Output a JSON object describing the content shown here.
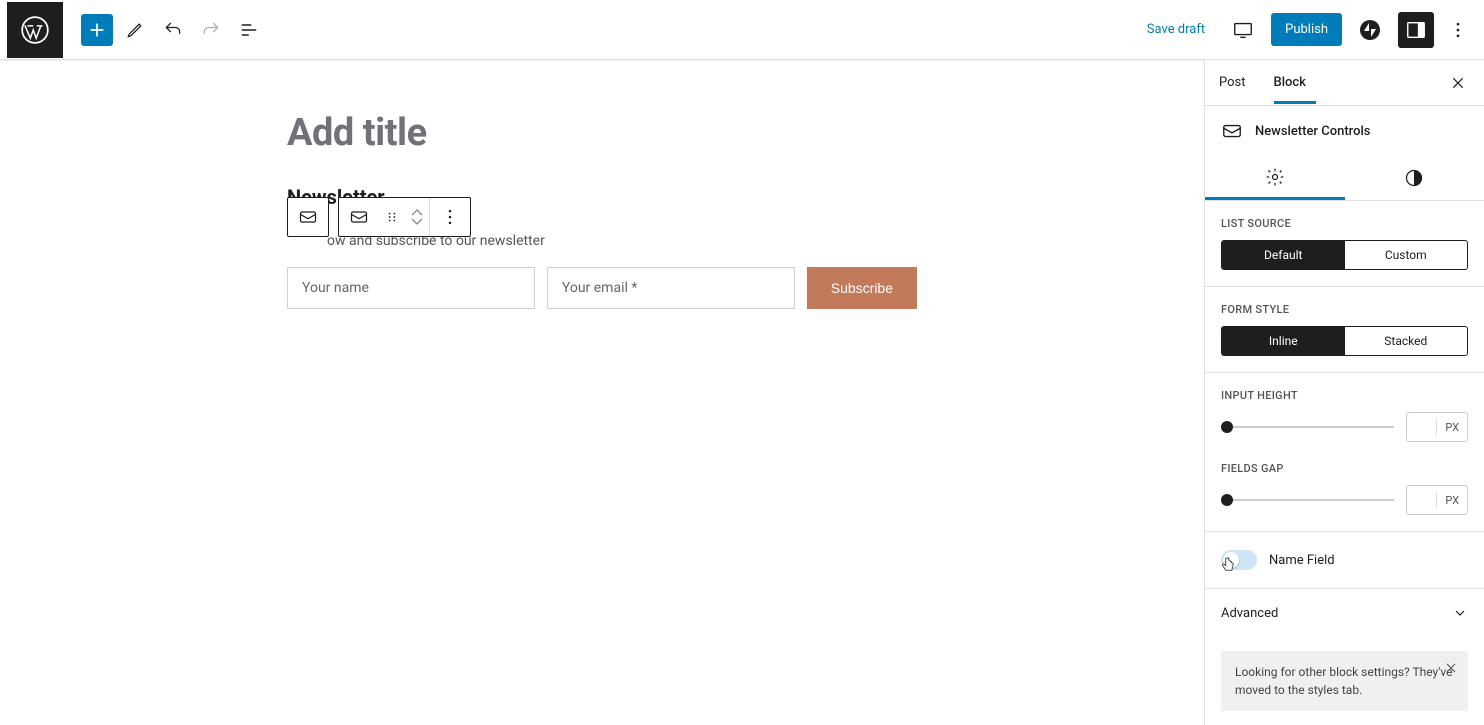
{
  "header": {
    "save_draft": "Save draft",
    "publish": "Publish"
  },
  "canvas": {
    "title_placeholder": "Add title",
    "newsletter_heading": "Newsletter",
    "newsletter_desc": "ow and subscribe to our newsletter",
    "name_placeholder": "Your name",
    "email_placeholder": "Your email *",
    "subscribe_label": "Subscribe"
  },
  "sidebar": {
    "tabs": {
      "post": "Post",
      "block": "Block"
    },
    "block_name": "Newsletter Controls",
    "list_source": {
      "label": "LIST SOURCE",
      "default": "Default",
      "custom": "Custom"
    },
    "form_style": {
      "label": "FORM STYLE",
      "inline": "Inline",
      "stacked": "Stacked"
    },
    "input_height": {
      "label": "INPUT HEIGHT",
      "unit": "PX"
    },
    "fields_gap": {
      "label": "FIELDS GAP",
      "unit": "PX"
    },
    "name_field_label": "Name Field",
    "advanced": "Advanced",
    "hint": "Looking for other block settings? They've moved to the styles tab."
  }
}
